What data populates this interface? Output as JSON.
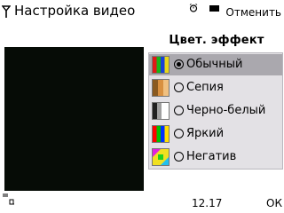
{
  "header": {
    "title": "Настройка видео",
    "right_softkey": "Отменить"
  },
  "panel": {
    "title": "Цвет. эффект",
    "options": [
      {
        "label": "Обычный",
        "selected": true,
        "icon": "normal-swatch-icon"
      },
      {
        "label": "Сепия",
        "selected": false,
        "icon": "sepia-swatch-icon"
      },
      {
        "label": "Черно-белый",
        "selected": false,
        "icon": "black-white-swatch-icon"
      },
      {
        "label": "Яркий",
        "selected": false,
        "icon": "vivid-swatch-icon"
      },
      {
        "label": "Негатив",
        "selected": false,
        "icon": "negative-swatch-icon"
      }
    ]
  },
  "footer": {
    "time": "12.17",
    "left_softkey": "",
    "right_softkey": "ОК"
  },
  "colors": {
    "selected_row": "#aaa8ae",
    "list_background": "#e3e1e5",
    "preview_background": "#060c06"
  }
}
